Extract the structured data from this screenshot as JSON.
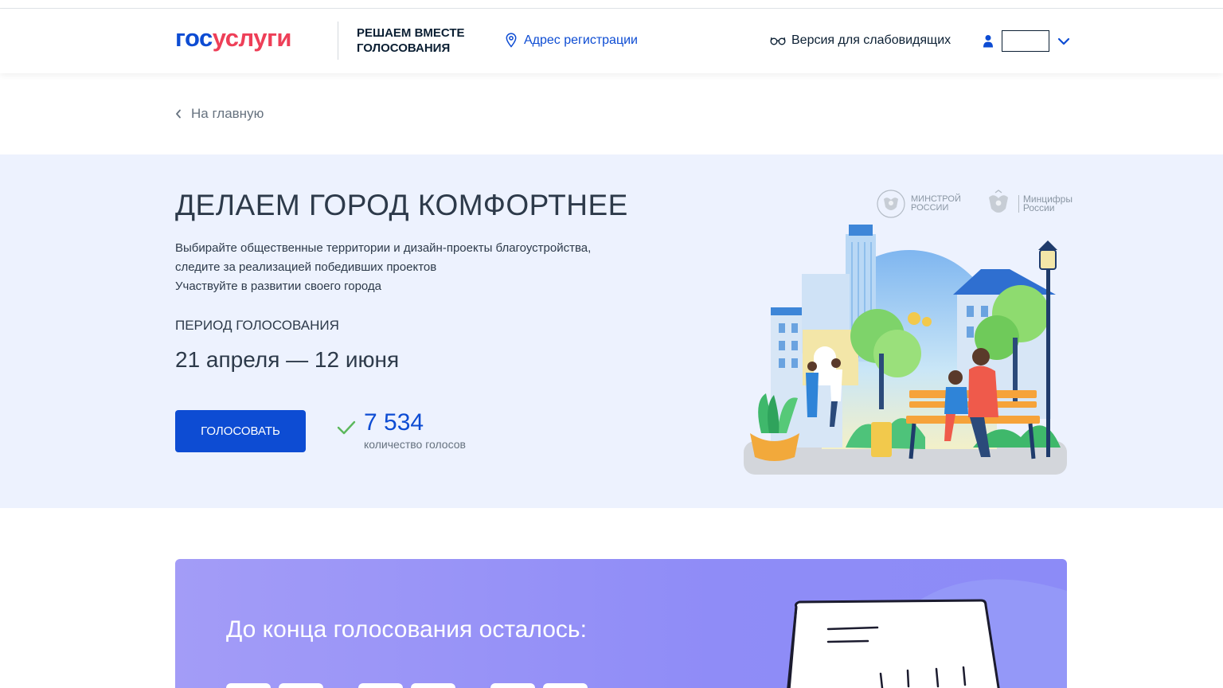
{
  "header": {
    "logo_part1": "гос",
    "logo_part2": "услуги",
    "slogan": "РЕШАЕМ ВМЕСТЕ ГОЛОСОВАНИЯ",
    "address_link": "Адрес регистрации",
    "vision_link": "Версия для слабовидящих"
  },
  "breadcrumb": {
    "back_label": "На главную"
  },
  "hero": {
    "title": "ДЕЛАЕМ ГОРОД КОМФОРТНЕЕ",
    "desc_line1": "Выбирайте общественные территории и дизайн-проекты благоустройства,",
    "desc_line2": "следите за реализацией победивших проектов",
    "desc_line3": "Участвуйте в развитии своего города",
    "period_label": "ПЕРИОД ГОЛОСОВАНИЯ",
    "period": "21 апреля — 12 июня",
    "vote_button": "ГОЛОСОВАТЬ",
    "votes_count": "7 534",
    "votes_label": "количество голосов",
    "ministry1_line1": "МИНСТРОЙ",
    "ministry1_line2": "РОССИИ",
    "ministry2_line1": "Минцифры",
    "ministry2_line2": "России"
  },
  "countdown": {
    "title": "До конца голосования осталось:"
  },
  "colors": {
    "brand_blue": "#0d4cd3",
    "brand_red": "#ee3f58",
    "hero_bg": "#edf2fe",
    "countdown_bg": "#8f8cf7"
  }
}
